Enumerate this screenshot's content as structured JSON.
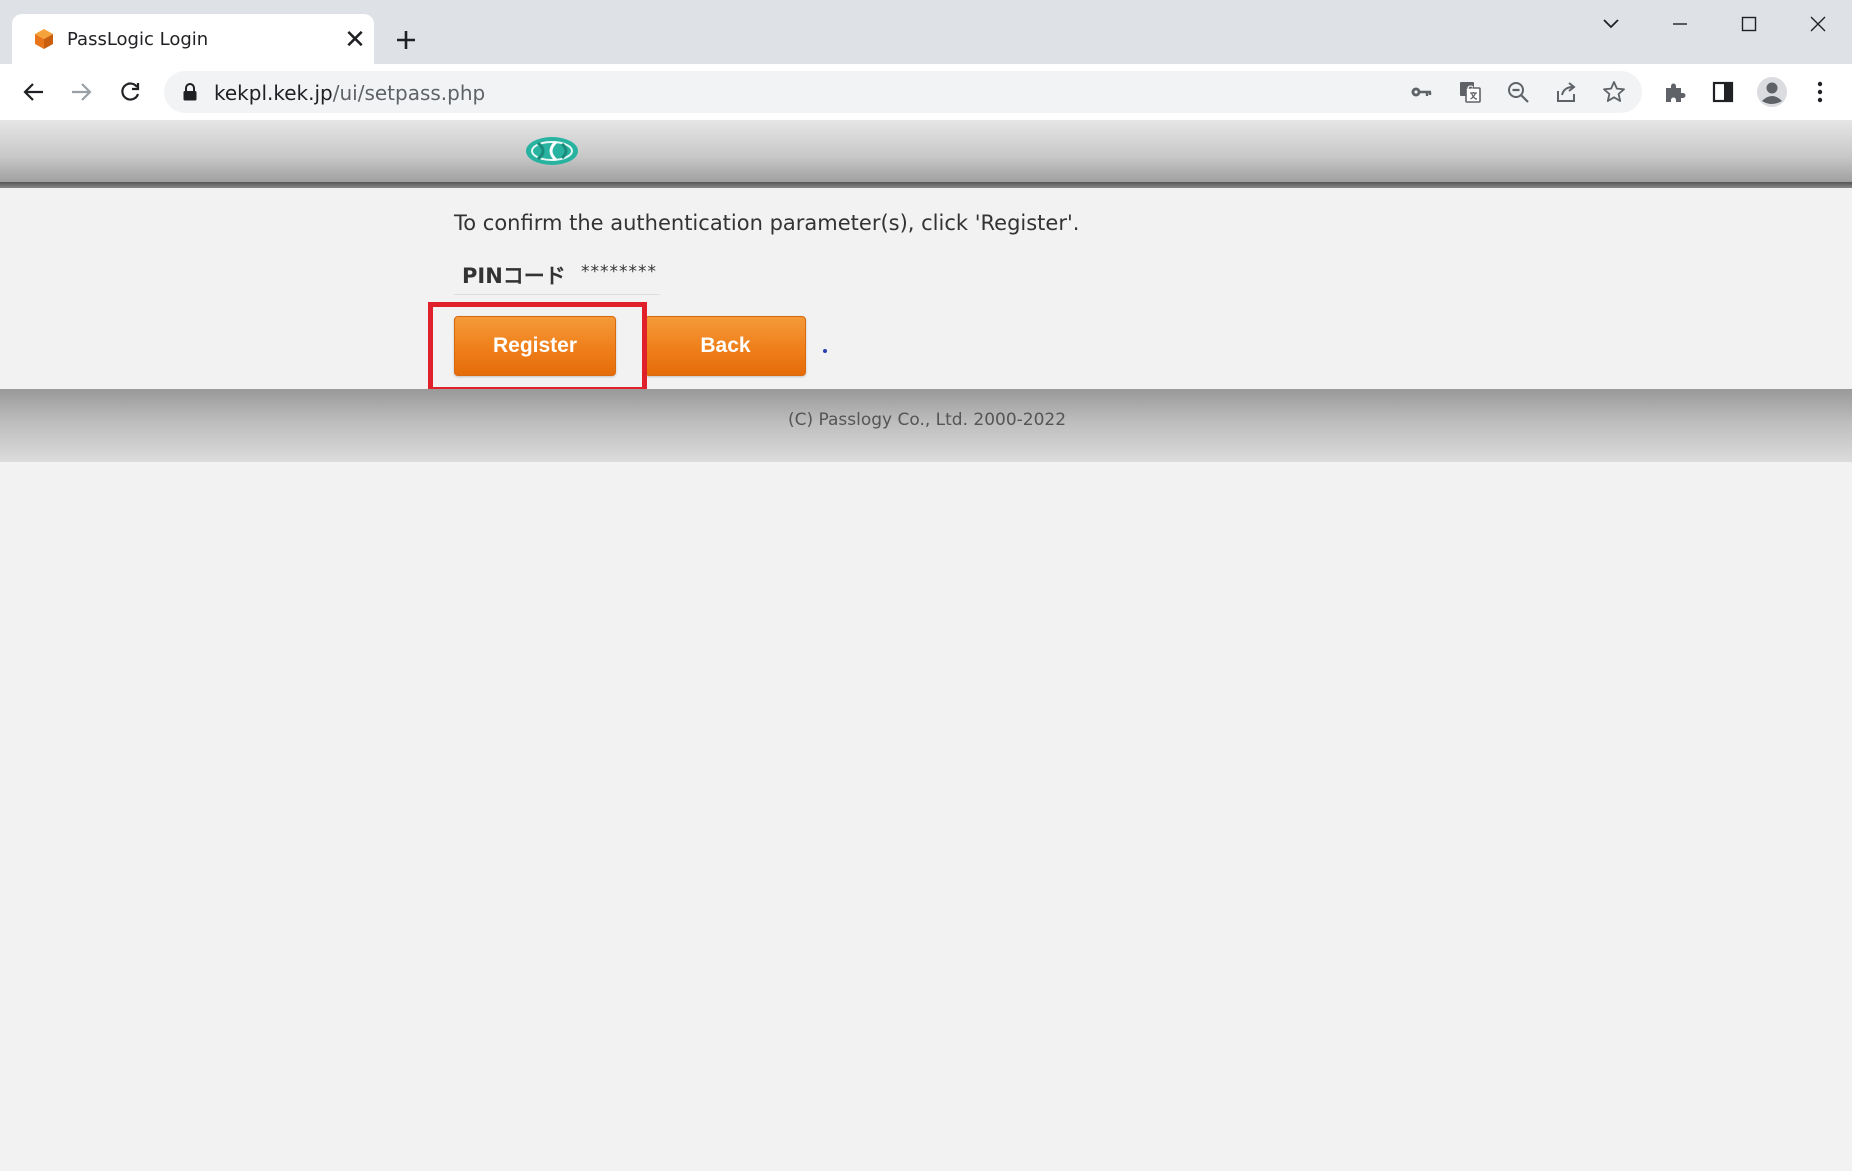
{
  "browser": {
    "tab": {
      "title": "PassLogic Login",
      "close_glyph": "✕"
    },
    "new_tab_label": "+",
    "url": {
      "host": "kekpl.kek.jp",
      "path": "/ui/setpass.php"
    }
  },
  "page": {
    "instructions": "To confirm the authentication parameter(s), click 'Register'.",
    "param": {
      "label": "PINコード",
      "value": "********"
    },
    "buttons": {
      "register": "Register",
      "back": "Back"
    },
    "footer": {
      "copyright": "(C) Passlogy Co., Ltd. 2000-2022"
    }
  },
  "colors": {
    "button_orange": "#ef7f1a",
    "highlight_red": "#e0202b",
    "logo_teal": "#27b3a0"
  }
}
